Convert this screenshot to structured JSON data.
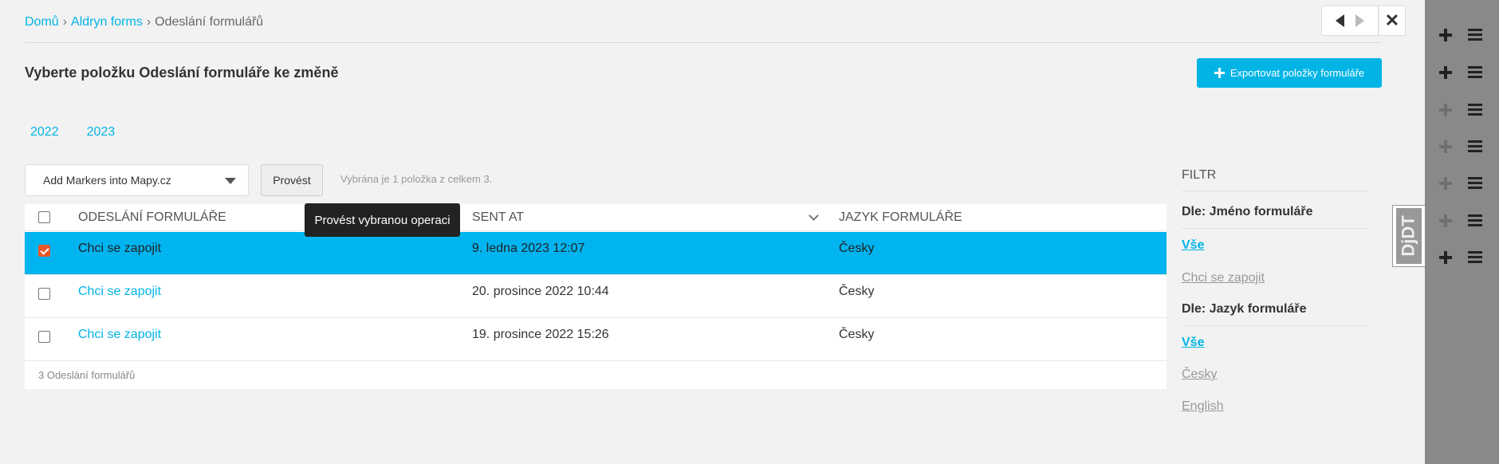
{
  "breadcrumb": {
    "home": "Domů",
    "app": "Aldryn forms",
    "current": "Odeslání formulářů",
    "separator": "›"
  },
  "page": {
    "title": "Vyberte položku Odeslání formuláře ke změně",
    "export_label": "Exportovat položky formuláře"
  },
  "date_hierarchy": [
    "2022",
    "2023"
  ],
  "actions": {
    "selected_action": "Add Markers into Mapy.cz",
    "run_label": "Provést",
    "run_tooltip": "Provést vybranou operaci",
    "selection_counter": "Vybrána je 1 položka z celkem 3."
  },
  "table": {
    "columns": [
      "Odeslání formuláře",
      "Sent at",
      "Jazyk formuláře"
    ],
    "rows": [
      {
        "name": "Chci se zapojit",
        "sent_at": "9. ledna 2023 12:07",
        "language": "Česky",
        "selected": true
      },
      {
        "name": "Chci se zapojit",
        "sent_at": "20. prosince 2022 10:44",
        "language": "Česky",
        "selected": false
      },
      {
        "name": "Chci se zapojit",
        "sent_at": "19. prosince 2022 15:26",
        "language": "Česky",
        "selected": false
      }
    ],
    "footer": "3 Odeslání formulářů"
  },
  "filter": {
    "title": "FILTR",
    "groups": [
      {
        "heading": "Dle: Jméno formuláře",
        "options": [
          "Vše",
          "Chci se zapojit"
        ],
        "active": "Vše"
      },
      {
        "heading": "Dle: Jazyk formuláře",
        "options": [
          "Vše",
          "Česky",
          "English"
        ],
        "active": "Vše"
      }
    ]
  },
  "debug_toolbar": {
    "label": "DjDT"
  },
  "colors": {
    "accent": "#00b4e6",
    "checkbox_checked": "#e8572a",
    "side_panel": "#898989"
  }
}
